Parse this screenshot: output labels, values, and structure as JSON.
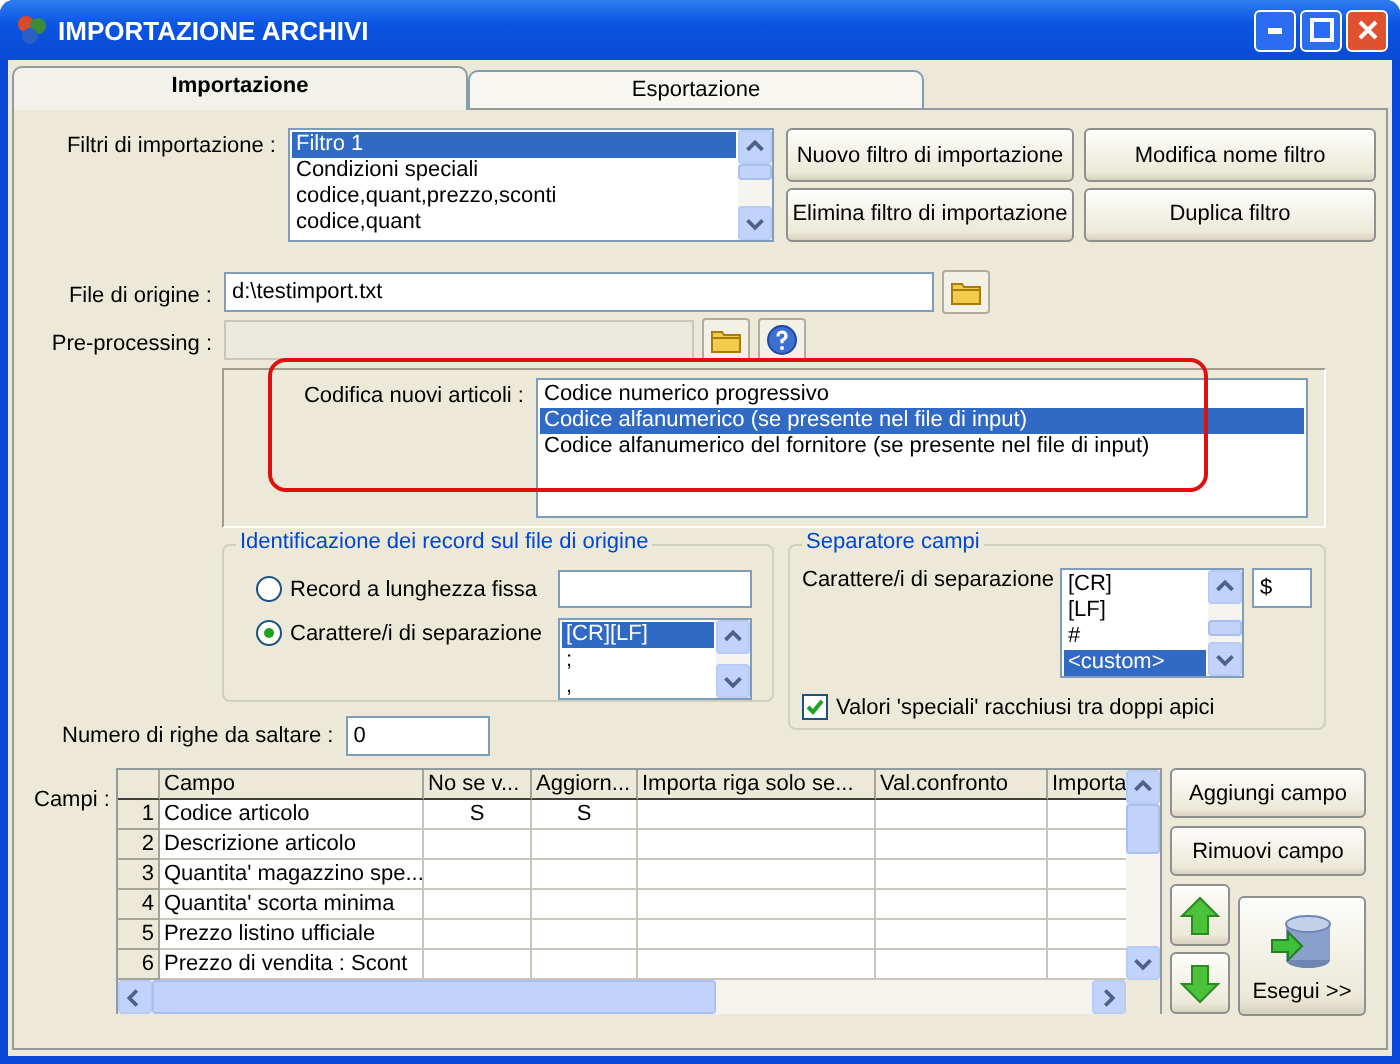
{
  "window": {
    "title": "IMPORTAZIONE ARCHIVI"
  },
  "tabs": [
    {
      "label": "Importazione",
      "selected": true
    },
    {
      "label": "Esportazione",
      "selected": false
    }
  ],
  "import_filters": {
    "label": "Filtri di importazione :",
    "items": [
      {
        "text": "Filtro 1",
        "selected": true
      },
      {
        "text": "Condizioni speciali",
        "selected": false
      },
      {
        "text": "codice,quant,prezzo,sconti",
        "selected": false
      },
      {
        "text": "codice,quant",
        "selected": false
      }
    ],
    "buttons": [
      "Nuovo filtro di importazione",
      "Modifica nome filtro",
      "Elimina filtro di importazione",
      "Duplica filtro"
    ]
  },
  "source_file": {
    "label": "File di origine :",
    "value": "d:\\testimport.txt"
  },
  "preprocessing": {
    "label": "Pre-processing :",
    "disabled": true
  },
  "new_item_coding": {
    "label": "Codifica nuovi articoli :",
    "highlighted": true,
    "options": [
      {
        "text": "Codice numerico progressivo",
        "selected": false
      },
      {
        "text": "Codice alfanumerico (se presente nel file di input)",
        "selected": true
      },
      {
        "text": "Codice alfanumerico del fornitore (se presente nel file di input)",
        "selected": false
      }
    ]
  },
  "record_identification": {
    "title": "Identificazione dei record sul file di origine",
    "options": [
      {
        "label": "Record a lunghezza fissa",
        "selected": false
      },
      {
        "label": "Carattere/i di separazione",
        "selected": true
      }
    ],
    "separators": [
      {
        "text": "[CR][LF]",
        "selected": true
      },
      {
        "text": ";",
        "selected": false
      },
      {
        "text": ",",
        "selected": false
      }
    ]
  },
  "field_separator": {
    "title": "Separatore campi",
    "label": "Carattere/i di separazione",
    "items": [
      {
        "text": "[CR]",
        "selected": false
      },
      {
        "text": "[LF]",
        "selected": false
      },
      {
        "text": "#",
        "selected": false
      },
      {
        "text": "<custom>",
        "selected": true
      }
    ],
    "custom_value": "$",
    "quoted_values": {
      "label": "Valori 'speciali' racchiusi tra doppi apici",
      "checked": true
    }
  },
  "skip_rows": {
    "label": "Numero di righe da saltare :",
    "value": "0"
  },
  "fields": {
    "label": "Campi :",
    "columns": [
      "Campo",
      "No se v...",
      "Aggiorn...",
      "Importa riga solo se...",
      "Val.confronto",
      "Importa"
    ],
    "rows": [
      {
        "number": "1",
        "cells": [
          "Codice articolo",
          "S",
          "S",
          "",
          "",
          ""
        ]
      },
      {
        "number": "2",
        "cells": [
          "Descrizione articolo",
          "",
          "",
          "",
          "",
          ""
        ]
      },
      {
        "number": "3",
        "cells": [
          "Quantita' magazzino spe...",
          "",
          "",
          "",
          "",
          ""
        ]
      },
      {
        "number": "4",
        "cells": [
          "Quantita' scorta minima",
          "",
          "",
          "",
          "",
          ""
        ]
      },
      {
        "number": "5",
        "cells": [
          "Prezzo listino ufficiale",
          "",
          "",
          "",
          "",
          ""
        ]
      },
      {
        "number": "6",
        "cells": [
          "Prezzo di vendita : Scont",
          "",
          "",
          "",
          "",
          ""
        ]
      }
    ]
  },
  "field_buttons": {
    "add": "Aggiungi campo",
    "remove": "Rimuovi campo",
    "run": "Esegui >>"
  }
}
